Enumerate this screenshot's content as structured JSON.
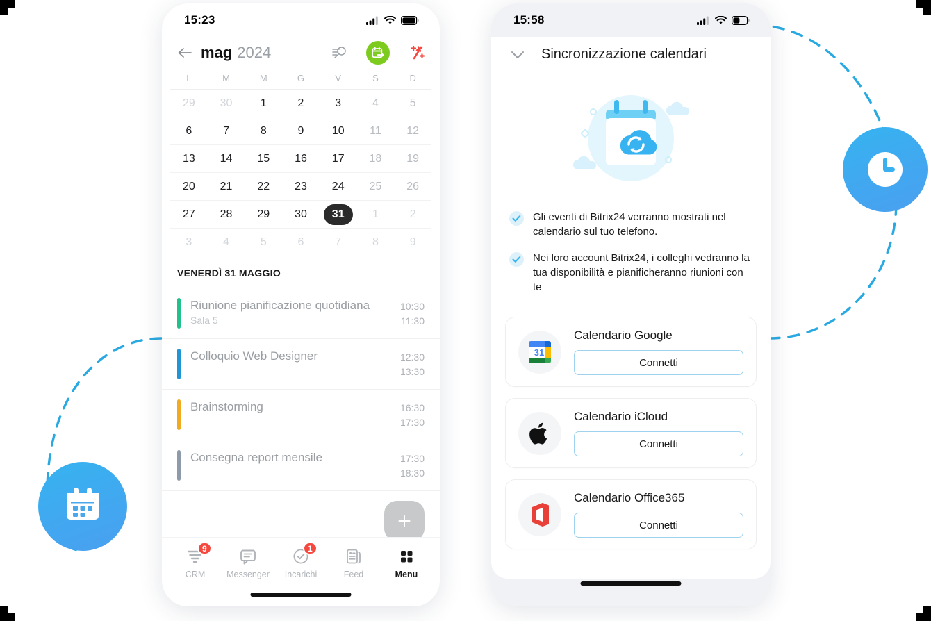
{
  "corner_marks": [
    "top-left",
    "top-right",
    "bottom-left",
    "bottom-right"
  ],
  "colors": {
    "accent_blue": "#36b3f0",
    "green_button": "#7ecb1f",
    "red_icon": "#f5483f",
    "badge_red": "#f5483f",
    "selected_day": "#2b2b2b",
    "event_green": "#22c08a",
    "event_blue": "#2196d6",
    "event_orange": "#f0ab21",
    "event_slate": "#8e9aa8",
    "connect_border": "#9ed2ee"
  },
  "decor": {
    "calendar_badge_icon": "calendar-icon",
    "clock_badge_icon": "clock-icon",
    "dashed_arc_left": "dashed-arc",
    "dashed_arc_right": "dashed-arc"
  },
  "left_phone": {
    "status": {
      "time": "15:23",
      "cellular": "signal-icon",
      "wifi": "wifi-icon",
      "battery": "battery-full-icon"
    },
    "header": {
      "back": "back-arrow-icon",
      "month": "mag",
      "year": "2024",
      "search_icon": "search-list-icon",
      "share_icon": "calendar-share-icon",
      "ai_icon": "ai-sparkle-icon"
    },
    "weekdays": [
      "L",
      "M",
      "M",
      "G",
      "V",
      "S",
      "D"
    ],
    "weeks": [
      [
        {
          "n": "29",
          "muted": true
        },
        {
          "n": "30",
          "muted": true
        },
        {
          "n": "1"
        },
        {
          "n": "2"
        },
        {
          "n": "3"
        },
        {
          "n": "4",
          "weekend": true
        },
        {
          "n": "5",
          "weekend": true
        }
      ],
      [
        {
          "n": "6"
        },
        {
          "n": "7"
        },
        {
          "n": "8"
        },
        {
          "n": "9"
        },
        {
          "n": "10"
        },
        {
          "n": "11",
          "weekend": true
        },
        {
          "n": "12",
          "weekend": true
        }
      ],
      [
        {
          "n": "13"
        },
        {
          "n": "14"
        },
        {
          "n": "15"
        },
        {
          "n": "16"
        },
        {
          "n": "17"
        },
        {
          "n": "18",
          "weekend": true
        },
        {
          "n": "19",
          "weekend": true
        }
      ],
      [
        {
          "n": "20"
        },
        {
          "n": "21"
        },
        {
          "n": "22"
        },
        {
          "n": "23"
        },
        {
          "n": "24"
        },
        {
          "n": "25",
          "weekend": true
        },
        {
          "n": "26",
          "weekend": true
        }
      ],
      [
        {
          "n": "27"
        },
        {
          "n": "28"
        },
        {
          "n": "29"
        },
        {
          "n": "30"
        },
        {
          "n": "31",
          "selected": true
        },
        {
          "n": "1",
          "muted": true
        },
        {
          "n": "2",
          "muted": true
        }
      ],
      [
        {
          "n": "3",
          "muted": true
        },
        {
          "n": "4",
          "muted": true
        },
        {
          "n": "5",
          "muted": true
        },
        {
          "n": "6",
          "muted": true
        },
        {
          "n": "7",
          "muted": true
        },
        {
          "n": "8",
          "muted": true
        },
        {
          "n": "9",
          "muted": true
        }
      ]
    ],
    "day_title": "VENERDÌ 31 MAGGIO",
    "events": [
      {
        "title": "Riunione pianificazione quotidiana",
        "sub": "Sala 5",
        "start": "10:30",
        "end": "11:30",
        "color": "#22c08a"
      },
      {
        "title": "Colloquio Web Designer",
        "sub": "",
        "start": "12:30",
        "end": "13:30",
        "color": "#2196d6"
      },
      {
        "title": "Brainstorming",
        "sub": "",
        "start": "16:30",
        "end": "17:30",
        "color": "#f0ab21"
      },
      {
        "title": "Consegna report mensile",
        "sub": "",
        "start": "17:30",
        "end": "18:30",
        "color": "#8e9aa8"
      }
    ],
    "fab": "add-event-icon",
    "nav": [
      {
        "label": "CRM",
        "icon": "crm-funnel-icon",
        "badge": "9",
        "active": false
      },
      {
        "label": "Messenger",
        "icon": "chat-bubble-icon",
        "badge": "",
        "active": false
      },
      {
        "label": "Incarichi",
        "icon": "check-circle-icon",
        "badge": "1",
        "active": false
      },
      {
        "label": "Feed",
        "icon": "news-feed-icon",
        "badge": "",
        "active": false
      },
      {
        "label": "Menu",
        "icon": "grid-menu-icon",
        "badge": "",
        "active": true
      }
    ]
  },
  "right_phone": {
    "status": {
      "time": "15:58",
      "cellular": "signal-icon",
      "wifi": "wifi-icon",
      "battery": "battery-half-icon"
    },
    "header": {
      "collapse_icon": "chevron-down-icon",
      "title": "Sincronizzazione calendari"
    },
    "illustration": "calendar-cloud-sync-icon",
    "bullets": [
      "Gli eventi di Bitrix24 verranno mostrati nel calendario sul tuo telefono.",
      "Nei loro account Bitrix24, i colleghi vedranno la tua disponibilità e pianificheranno riunioni con te"
    ],
    "providers": [
      {
        "title": "Calendario Google",
        "button": "Connetti",
        "logo": "google-calendar-icon"
      },
      {
        "title": "Calendario iCloud",
        "button": "Connetti",
        "logo": "apple-icon"
      },
      {
        "title": "Calendario Office365",
        "button": "Connetti",
        "logo": "office365-icon"
      }
    ]
  }
}
